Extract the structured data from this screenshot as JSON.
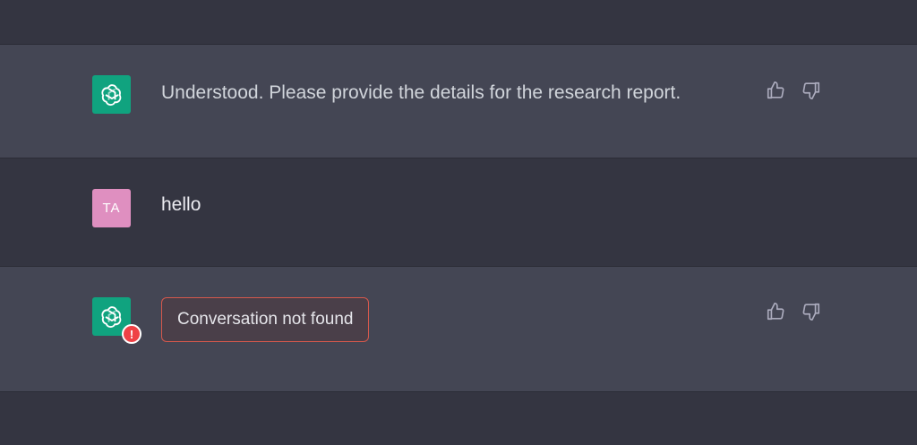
{
  "messages": [
    {
      "role": "assistant",
      "avatar_icon": "openai-logo-icon",
      "text": "Understood. Please provide the details for the research report."
    },
    {
      "role": "user",
      "avatar_initials": "TA",
      "text": "hello"
    },
    {
      "role": "assistant",
      "avatar_icon": "openai-logo-icon",
      "error_badge": "!",
      "error_text": "Conversation not found"
    }
  ],
  "icons": {
    "thumbs_up": "thumbs-up-icon",
    "thumbs_down": "thumbs-down-icon"
  },
  "colors": {
    "assistant_bg": "#444654",
    "user_bg": "#343541",
    "gpt_avatar": "#10a37f",
    "user_avatar": "#df8fc0",
    "error_border": "#d5584c",
    "error_badge": "#ef4146"
  }
}
